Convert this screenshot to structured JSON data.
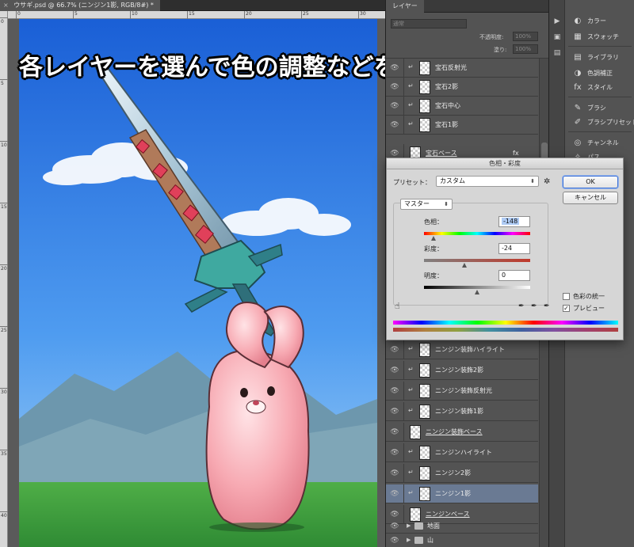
{
  "document": {
    "tab_title": "ウサギ.psd @ 66.7% (ニンジン1影, RGB/8#) *",
    "close_glyph": "×"
  },
  "caption": "各レイヤーを選んで色の調整などを行い…",
  "rulers": {
    "top": [
      "0",
      "5",
      "10",
      "15",
      "20",
      "25",
      "30"
    ],
    "left": [
      "0",
      "5",
      "10",
      "15",
      "20",
      "25",
      "30",
      "35",
      "40"
    ]
  },
  "layers_panel": {
    "tab": "レイヤー",
    "blend_mode": "通常",
    "opacity_label": "不透明度:",
    "opacity_value": "100%",
    "fill_label": "塗り:",
    "fill_value": "100%",
    "layers": [
      {
        "name": "宝石反射光",
        "clipped": true,
        "selected": false
      },
      {
        "name": "宝石2影",
        "clipped": true,
        "selected": false
      },
      {
        "name": "宝石中心",
        "clipped": true,
        "selected": false
      },
      {
        "name": "宝石1影",
        "clipped": true,
        "selected": false
      },
      {
        "name": "宝石ベース",
        "clipped": false,
        "selected": false
      },
      {
        "name": "ニンジン装飾ハイライト",
        "clipped": true,
        "selected": false
      },
      {
        "name": "ニンジン装飾2影",
        "clipped": true,
        "selected": false
      },
      {
        "name": "ニンジン装飾反射光",
        "clipped": true,
        "selected": false
      },
      {
        "name": "ニンジン装飾1影",
        "clipped": true,
        "selected": false
      },
      {
        "name": "ニンジン装飾ベース",
        "clipped": false,
        "selected": false
      },
      {
        "name": "ニンジンハイライト",
        "clipped": true,
        "selected": false
      },
      {
        "name": "ニンジン2影",
        "clipped": true,
        "selected": false
      },
      {
        "name": "ニンジン1影",
        "clipped": true,
        "selected": true
      },
      {
        "name": "ニンジンベース",
        "clipped": false,
        "selected": false
      }
    ],
    "folders": [
      {
        "name": "地面"
      },
      {
        "name": "山"
      }
    ],
    "eye_glyph": "👁",
    "clip_glyph": "↵",
    "fx_glyph": "fx"
  },
  "dock": {
    "items": [
      {
        "icon": "palette-icon",
        "glyph": "◐",
        "label": "カラー"
      },
      {
        "icon": "swatches-icon",
        "glyph": "▦",
        "label": "スウォッチ"
      },
      {
        "icon": "library-icon",
        "glyph": "▤",
        "label": "ライブラリ"
      },
      {
        "icon": "adjustments-icon",
        "glyph": "◑",
        "label": "色調補正"
      },
      {
        "icon": "styles-icon",
        "glyph": "fx",
        "label": "スタイル"
      },
      {
        "icon": "brush-icon",
        "glyph": "✎",
        "label": "ブラシ"
      },
      {
        "icon": "brush-preset-icon",
        "glyph": "✐",
        "label": "ブラシプリセット"
      },
      {
        "icon": "channels-icon",
        "glyph": "◎",
        "label": "チャンネル"
      },
      {
        "icon": "paths-icon",
        "glyph": "✧",
        "label": "パス"
      }
    ]
  },
  "dialog": {
    "title": "色相・彩度",
    "preset_label": "プリセット：",
    "preset_value": "カスタム",
    "channel_value": "マスター",
    "hue_label": "色相：",
    "hue_value": "-148",
    "saturation_label": "彩度：",
    "saturation_value": "-24",
    "lightness_label": "明度：",
    "lightness_value": "0",
    "hue_slider_fraction": 0.09,
    "saturation_slider_fraction": 0.38,
    "lightness_slider_fraction": 0.5,
    "ok_label": "OK",
    "cancel_label": "キャンセル",
    "colorize_label": "色彩の統一",
    "colorize_checked": false,
    "preview_label": "プレビュー",
    "preview_checked": true,
    "check_glyph": "✓",
    "arrow_glyph": "⬍",
    "gear_glyph": "✲",
    "hand_glyph": "☝"
  }
}
